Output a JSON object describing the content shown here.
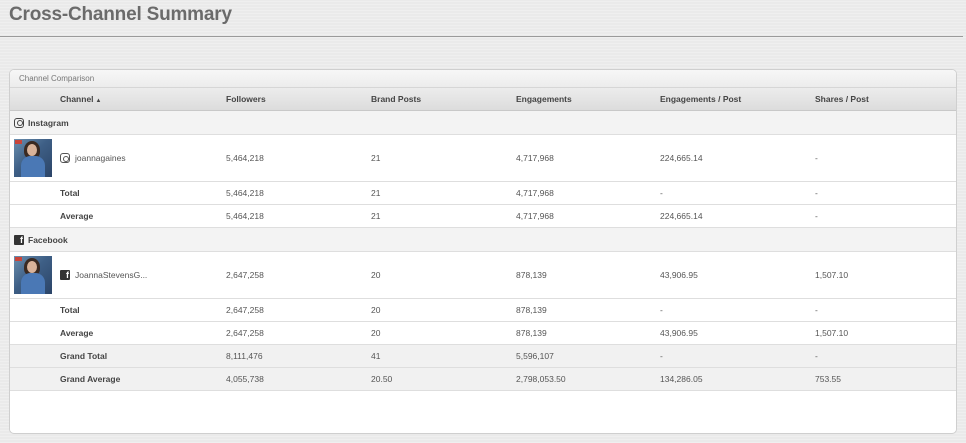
{
  "page": {
    "title": "Cross-Channel Summary"
  },
  "panel": {
    "title": "Channel Comparison"
  },
  "columns": {
    "channel": "Channel",
    "sort_indicator": "▲",
    "followers": "Followers",
    "brand_posts": "Brand Posts",
    "engagements": "Engagements",
    "engagements_per_post": "Engagements / Post",
    "shares_per_post": "Shares / Post"
  },
  "sections": [
    {
      "name": "Instagram",
      "icon": "instagram-icon",
      "account": {
        "name": "joannagaines",
        "followers": "5,464,218",
        "brand_posts": "21",
        "engagements": "4,717,968",
        "engagements_per_post": "224,665.14",
        "shares_per_post": "-"
      },
      "total": {
        "label": "Total",
        "followers": "5,464,218",
        "brand_posts": "21",
        "engagements": "4,717,968",
        "engagements_per_post": "-",
        "shares_per_post": "-"
      },
      "average": {
        "label": "Average",
        "followers": "5,464,218",
        "brand_posts": "21",
        "engagements": "4,717,968",
        "engagements_per_post": "224,665.14",
        "shares_per_post": "-"
      }
    },
    {
      "name": "Facebook",
      "icon": "facebook-icon",
      "account": {
        "name": "JoannaStevensG...",
        "followers": "2,647,258",
        "brand_posts": "20",
        "engagements": "878,139",
        "engagements_per_post": "43,906.95",
        "shares_per_post": "1,507.10"
      },
      "total": {
        "label": "Total",
        "followers": "2,647,258",
        "brand_posts": "20",
        "engagements": "878,139",
        "engagements_per_post": "-",
        "shares_per_post": "-"
      },
      "average": {
        "label": "Average",
        "followers": "2,647,258",
        "brand_posts": "20",
        "engagements": "878,139",
        "engagements_per_post": "43,906.95",
        "shares_per_post": "1,507.10"
      }
    }
  ],
  "grand_total": {
    "label": "Grand Total",
    "followers": "8,111,476",
    "brand_posts": "41",
    "engagements": "5,596,107",
    "engagements_per_post": "-",
    "shares_per_post": "-"
  },
  "grand_average": {
    "label": "Grand Average",
    "followers": "4,055,738",
    "brand_posts": "20.50",
    "engagements": "2,798,053.50",
    "engagements_per_post": "134,286.05",
    "shares_per_post": "753.55"
  }
}
